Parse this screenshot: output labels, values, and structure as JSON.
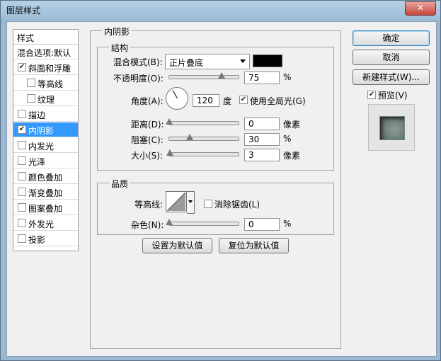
{
  "window": {
    "title": "图层样式",
    "close": "✕"
  },
  "style_list": {
    "header": "样式",
    "blend_options": "混合选项:默认",
    "items": [
      {
        "label": "斜面和浮雕",
        "checked": true,
        "indent": false,
        "selected": false
      },
      {
        "label": "等高线",
        "checked": false,
        "indent": true,
        "selected": false
      },
      {
        "label": "纹理",
        "checked": false,
        "indent": true,
        "selected": false
      },
      {
        "label": "描边",
        "checked": false,
        "indent": false,
        "selected": false
      },
      {
        "label": "内阴影",
        "checked": true,
        "indent": false,
        "selected": true
      },
      {
        "label": "内发光",
        "checked": false,
        "indent": false,
        "selected": false
      },
      {
        "label": "光泽",
        "checked": false,
        "indent": false,
        "selected": false
      },
      {
        "label": "颜色叠加",
        "checked": false,
        "indent": false,
        "selected": false
      },
      {
        "label": "渐变叠加",
        "checked": false,
        "indent": false,
        "selected": false
      },
      {
        "label": "图案叠加",
        "checked": false,
        "indent": false,
        "selected": false
      },
      {
        "label": "外发光",
        "checked": false,
        "indent": false,
        "selected": false
      },
      {
        "label": "投影",
        "checked": false,
        "indent": false,
        "selected": false
      }
    ]
  },
  "panel": {
    "title": "内阴影",
    "structure": {
      "title": "结构",
      "blend_mode_label": "混合模式(B):",
      "blend_mode_value": "正片叠底",
      "blend_color": "#000000",
      "opacity_label": "不透明度(O):",
      "opacity_value": "75",
      "opacity_fraction": 0.75,
      "angle_label": "角度(A):",
      "angle_value": "120",
      "angle_unit": "度",
      "use_global_light_label": "使用全局光(G)",
      "use_global_light_checked": true,
      "distance_label": "距离(D):",
      "distance_value": "0",
      "distance_unit": "像素",
      "distance_fraction": 0,
      "choke_label": "阻塞(C):",
      "choke_value": "30",
      "choke_fraction": 0.3,
      "size_label": "大小(S):",
      "size_value": "3",
      "size_unit": "像素",
      "size_fraction": 0.012,
      "percent": "%"
    },
    "quality": {
      "title": "品质",
      "contour_label": "等高线:",
      "antialias_label": "消除锯齿(L)",
      "antialias_checked": false,
      "noise_label": "杂色(N):",
      "noise_value": "0",
      "noise_fraction": 0,
      "percent": "%"
    },
    "set_default": "设置为默认值",
    "reset_default": "复位为默认值"
  },
  "side": {
    "ok": "确定",
    "cancel": "取消",
    "new_style": "新建样式(W)...",
    "preview_label": "预览(V)",
    "preview_checked": true
  }
}
